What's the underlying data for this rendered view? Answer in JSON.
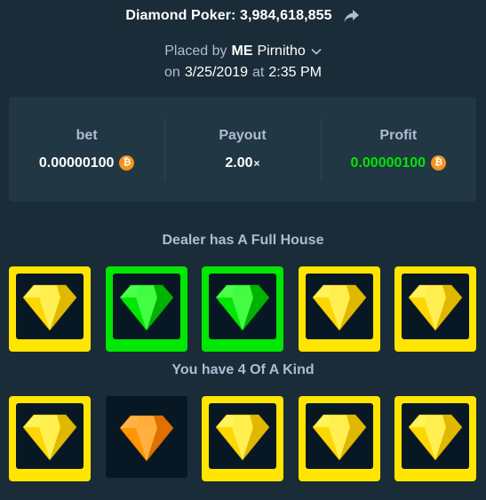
{
  "header": {
    "title": "Diamond Poker: 3,984,618,855",
    "placed_prefix": "Placed by",
    "user_tag": "ME",
    "username": "Pirnitho",
    "date_prefix": "on",
    "date": "3/25/2019",
    "at_word": "at",
    "time": "2:35 PM"
  },
  "stats": {
    "bet_label": "bet",
    "bet_value": "0.00000100",
    "payout_label": "Payout",
    "payout_value": "2.00",
    "payout_suffix": "×",
    "profit_label": "Profit",
    "profit_value": "0.00000100",
    "currency_symbol": "₿"
  },
  "dealer": {
    "title": "Dealer has A Full House",
    "cards": [
      {
        "gem": "yellow",
        "frame": "yellow"
      },
      {
        "gem": "green",
        "frame": "green"
      },
      {
        "gem": "green",
        "frame": "green"
      },
      {
        "gem": "yellow",
        "frame": "yellow"
      },
      {
        "gem": "yellow",
        "frame": "yellow"
      }
    ]
  },
  "player": {
    "title": "You have 4 Of A Kind",
    "cards": [
      {
        "gem": "yellow",
        "frame": "yellow"
      },
      {
        "gem": "orange",
        "frame": "none"
      },
      {
        "gem": "yellow",
        "frame": "yellow"
      },
      {
        "gem": "yellow",
        "frame": "yellow"
      },
      {
        "gem": "yellow",
        "frame": "yellow"
      }
    ]
  },
  "colors": {
    "background": "#1a2c38",
    "panel": "#213743",
    "profit_green": "#00e701",
    "frame_yellow": "#ffe500",
    "frame_green": "#00e701",
    "btc_orange": "#f7931a"
  },
  "icons": {
    "share": "share-arrow-icon",
    "chevron": "chevron-down-icon",
    "currency": "bitcoin-icon",
    "gem": "diamond-gem-icon"
  }
}
